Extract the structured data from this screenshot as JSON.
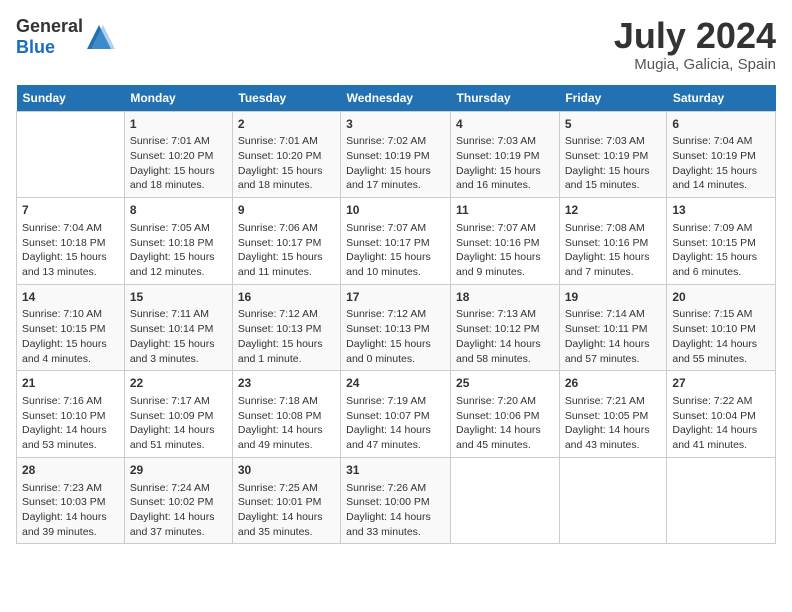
{
  "header": {
    "logo_general": "General",
    "logo_blue": "Blue",
    "title": "July 2024",
    "subtitle": "Mugia, Galicia, Spain"
  },
  "calendar": {
    "days_of_week": [
      "Sunday",
      "Monday",
      "Tuesday",
      "Wednesday",
      "Thursday",
      "Friday",
      "Saturday"
    ],
    "weeks": [
      [
        {
          "day": "",
          "info": ""
        },
        {
          "day": "1",
          "info": "Sunrise: 7:01 AM\nSunset: 10:20 PM\nDaylight: 15 hours\nand 18 minutes."
        },
        {
          "day": "2",
          "info": "Sunrise: 7:01 AM\nSunset: 10:20 PM\nDaylight: 15 hours\nand 18 minutes."
        },
        {
          "day": "3",
          "info": "Sunrise: 7:02 AM\nSunset: 10:19 PM\nDaylight: 15 hours\nand 17 minutes."
        },
        {
          "day": "4",
          "info": "Sunrise: 7:03 AM\nSunset: 10:19 PM\nDaylight: 15 hours\nand 16 minutes."
        },
        {
          "day": "5",
          "info": "Sunrise: 7:03 AM\nSunset: 10:19 PM\nDaylight: 15 hours\nand 15 minutes."
        },
        {
          "day": "6",
          "info": "Sunrise: 7:04 AM\nSunset: 10:19 PM\nDaylight: 15 hours\nand 14 minutes."
        }
      ],
      [
        {
          "day": "7",
          "info": "Sunrise: 7:04 AM\nSunset: 10:18 PM\nDaylight: 15 hours\nand 13 minutes."
        },
        {
          "day": "8",
          "info": "Sunrise: 7:05 AM\nSunset: 10:18 PM\nDaylight: 15 hours\nand 12 minutes."
        },
        {
          "day": "9",
          "info": "Sunrise: 7:06 AM\nSunset: 10:17 PM\nDaylight: 15 hours\nand 11 minutes."
        },
        {
          "day": "10",
          "info": "Sunrise: 7:07 AM\nSunset: 10:17 PM\nDaylight: 15 hours\nand 10 minutes."
        },
        {
          "day": "11",
          "info": "Sunrise: 7:07 AM\nSunset: 10:16 PM\nDaylight: 15 hours\nand 9 minutes."
        },
        {
          "day": "12",
          "info": "Sunrise: 7:08 AM\nSunset: 10:16 PM\nDaylight: 15 hours\nand 7 minutes."
        },
        {
          "day": "13",
          "info": "Sunrise: 7:09 AM\nSunset: 10:15 PM\nDaylight: 15 hours\nand 6 minutes."
        }
      ],
      [
        {
          "day": "14",
          "info": "Sunrise: 7:10 AM\nSunset: 10:15 PM\nDaylight: 15 hours\nand 4 minutes."
        },
        {
          "day": "15",
          "info": "Sunrise: 7:11 AM\nSunset: 10:14 PM\nDaylight: 15 hours\nand 3 minutes."
        },
        {
          "day": "16",
          "info": "Sunrise: 7:12 AM\nSunset: 10:13 PM\nDaylight: 15 hours\nand 1 minute."
        },
        {
          "day": "17",
          "info": "Sunrise: 7:12 AM\nSunset: 10:13 PM\nDaylight: 15 hours\nand 0 minutes."
        },
        {
          "day": "18",
          "info": "Sunrise: 7:13 AM\nSunset: 10:12 PM\nDaylight: 14 hours\nand 58 minutes."
        },
        {
          "day": "19",
          "info": "Sunrise: 7:14 AM\nSunset: 10:11 PM\nDaylight: 14 hours\nand 57 minutes."
        },
        {
          "day": "20",
          "info": "Sunrise: 7:15 AM\nSunset: 10:10 PM\nDaylight: 14 hours\nand 55 minutes."
        }
      ],
      [
        {
          "day": "21",
          "info": "Sunrise: 7:16 AM\nSunset: 10:10 PM\nDaylight: 14 hours\nand 53 minutes."
        },
        {
          "day": "22",
          "info": "Sunrise: 7:17 AM\nSunset: 10:09 PM\nDaylight: 14 hours\nand 51 minutes."
        },
        {
          "day": "23",
          "info": "Sunrise: 7:18 AM\nSunset: 10:08 PM\nDaylight: 14 hours\nand 49 minutes."
        },
        {
          "day": "24",
          "info": "Sunrise: 7:19 AM\nSunset: 10:07 PM\nDaylight: 14 hours\nand 47 minutes."
        },
        {
          "day": "25",
          "info": "Sunrise: 7:20 AM\nSunset: 10:06 PM\nDaylight: 14 hours\nand 45 minutes."
        },
        {
          "day": "26",
          "info": "Sunrise: 7:21 AM\nSunset: 10:05 PM\nDaylight: 14 hours\nand 43 minutes."
        },
        {
          "day": "27",
          "info": "Sunrise: 7:22 AM\nSunset: 10:04 PM\nDaylight: 14 hours\nand 41 minutes."
        }
      ],
      [
        {
          "day": "28",
          "info": "Sunrise: 7:23 AM\nSunset: 10:03 PM\nDaylight: 14 hours\nand 39 minutes."
        },
        {
          "day": "29",
          "info": "Sunrise: 7:24 AM\nSunset: 10:02 PM\nDaylight: 14 hours\nand 37 minutes."
        },
        {
          "day": "30",
          "info": "Sunrise: 7:25 AM\nSunset: 10:01 PM\nDaylight: 14 hours\nand 35 minutes."
        },
        {
          "day": "31",
          "info": "Sunrise: 7:26 AM\nSunset: 10:00 PM\nDaylight: 14 hours\nand 33 minutes."
        },
        {
          "day": "",
          "info": ""
        },
        {
          "day": "",
          "info": ""
        },
        {
          "day": "",
          "info": ""
        }
      ]
    ]
  }
}
